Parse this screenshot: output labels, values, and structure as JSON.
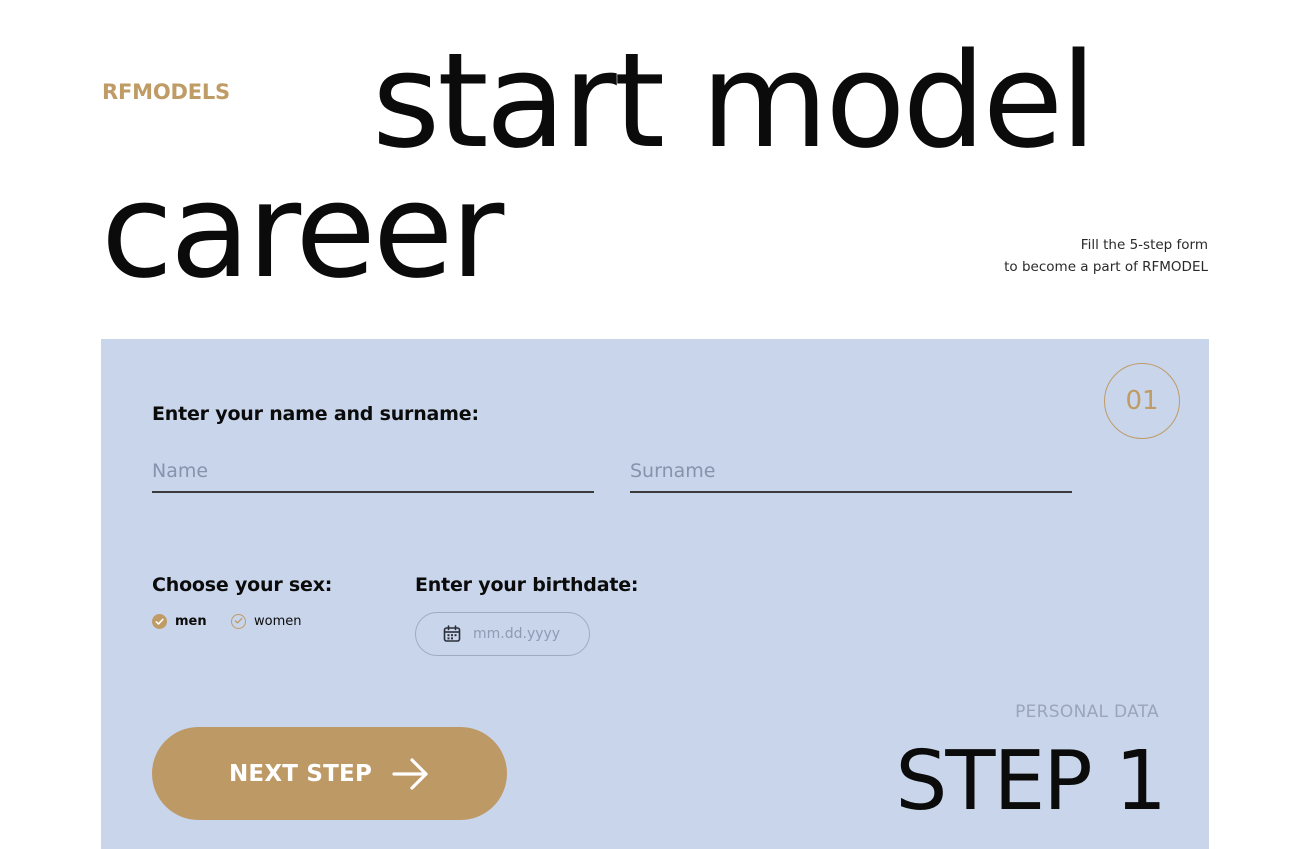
{
  "brand": {
    "logo": "RFMODELS",
    "accent_color": "#bf9b66"
  },
  "hero": {
    "line1": "start model",
    "line2": "career"
  },
  "subtitle": {
    "line1": "Fill the 5-step form",
    "line2": "to become a part of RFMODEL"
  },
  "form": {
    "panel_color": "#c9d5ea",
    "step_number": "01",
    "name_section": {
      "label": "Enter your name and surname:",
      "name_placeholder": "Name",
      "name_value": "",
      "surname_placeholder": "Surname",
      "surname_value": ""
    },
    "sex_section": {
      "label": "Choose your sex:",
      "options": [
        {
          "label": "men",
          "selected": true
        },
        {
          "label": "women",
          "selected": false
        }
      ]
    },
    "birthdate_section": {
      "label": "Enter your birthdate:",
      "icon": "calendar-icon",
      "placeholder": "mm.dd.yyyy"
    },
    "next_button": {
      "label": "NEXT STEP",
      "icon": "arrow-right-icon",
      "color": "#bd9966"
    },
    "step": {
      "caption": "PERSONAL DATA",
      "title": "STEP 1"
    }
  }
}
